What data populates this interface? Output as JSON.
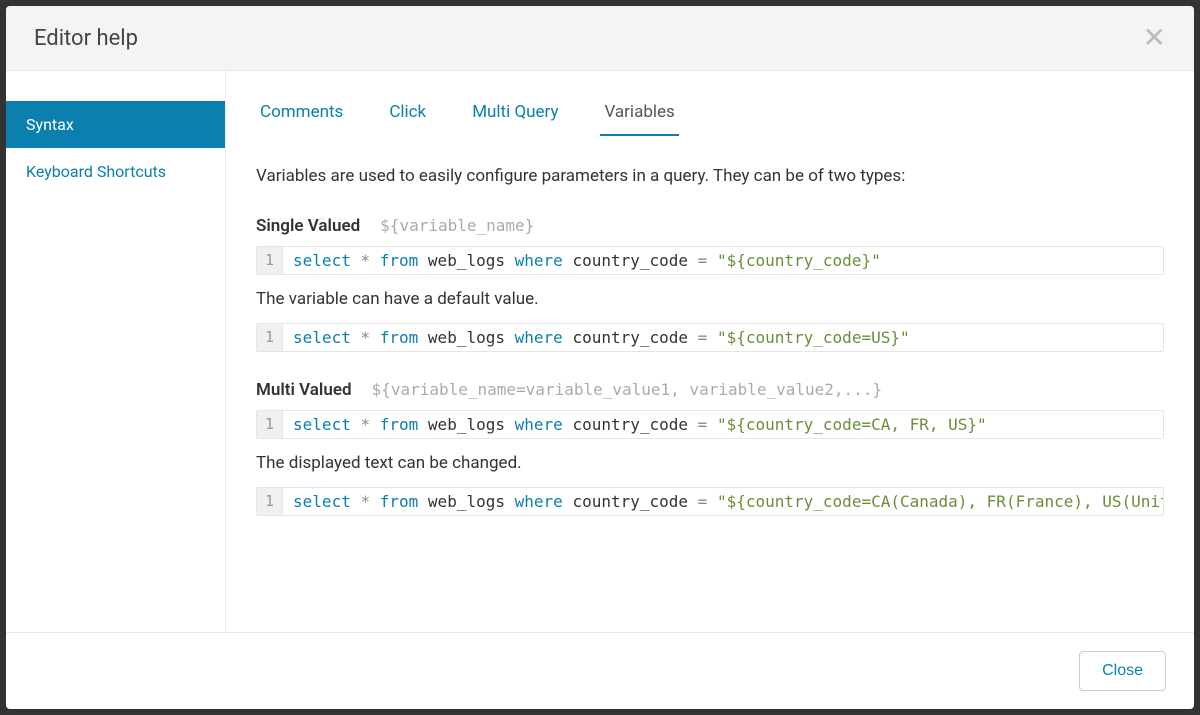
{
  "modal": {
    "title": "Editor help",
    "closeButton": "Close"
  },
  "sidebar": {
    "items": [
      {
        "label": "Syntax",
        "active": true
      },
      {
        "label": "Keyboard Shortcuts",
        "active": false
      }
    ]
  },
  "tabs": [
    {
      "label": "Comments",
      "active": false
    },
    {
      "label": "Click",
      "active": false
    },
    {
      "label": "Multi Query",
      "active": false
    },
    {
      "label": "Variables",
      "active": true
    }
  ],
  "variablesPanel": {
    "intro": "Variables are used to easily configure parameters in a query. They can be of two types:",
    "singleValued": {
      "heading": "Single Valued",
      "template": "${variable_name}",
      "defaultNote": "The variable can have a default value."
    },
    "multiValued": {
      "heading": "Multi Valued",
      "template": "${variable_name=variable_value1, variable_value2,...}",
      "displayNote": "The displayed text can be changed."
    },
    "codeExamples": {
      "lineNo": "1",
      "ex1": {
        "kw1": "select",
        "star": "*",
        "kw2": "from",
        "ident": "web_logs",
        "kw3": "where",
        "col": "country_code",
        "op": "=",
        "str": "\"${country_code}\""
      },
      "ex2": {
        "kw1": "select",
        "star": "*",
        "kw2": "from",
        "ident": "web_logs",
        "kw3": "where",
        "col": "country_code",
        "op": "=",
        "str": "\"${country_code=US}\""
      },
      "ex3": {
        "kw1": "select",
        "star": "*",
        "kw2": "from",
        "ident": "web_logs",
        "kw3": "where",
        "col": "country_code",
        "op": "=",
        "str": "\"${country_code=CA, FR, US}\""
      },
      "ex4": {
        "kw1": "select",
        "star": "*",
        "kw2": "from",
        "ident": "web_logs",
        "kw3": "where",
        "col": "country_code",
        "op": "=",
        "str": "\"${country_code=CA(Canada), FR(France), US(Unite"
      }
    }
  }
}
